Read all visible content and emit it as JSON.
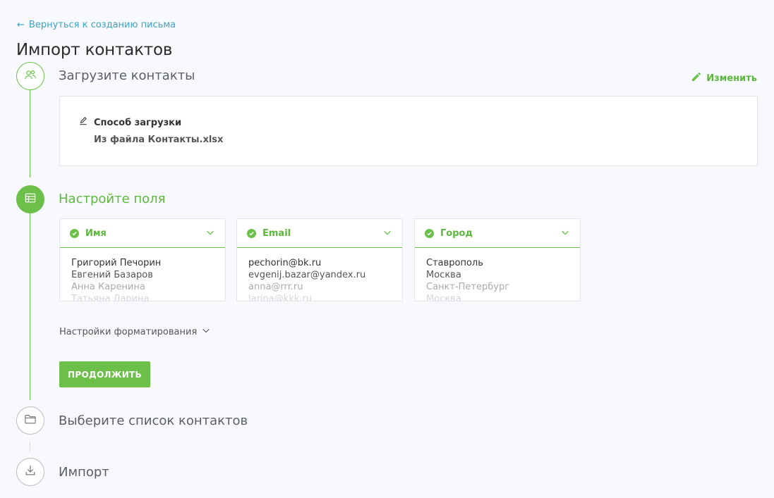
{
  "header": {
    "back_link": "Вернуться к созданию письма",
    "title": "Импорт контактов"
  },
  "steps": [
    {
      "title": "Загрузите контакты",
      "status": "done",
      "icon": "users-icon"
    },
    {
      "title": "Настройте поля",
      "status": "active",
      "icon": "table-icon"
    },
    {
      "title": "Выберите список контактов",
      "status": "todo",
      "icon": "folder-icon"
    },
    {
      "title": "Импорт",
      "status": "todo",
      "icon": "download-icon"
    }
  ],
  "upload": {
    "edit_label": "Изменить",
    "method_label": "Способ загрузки",
    "file_label": "Из файла Контакты.xlsx"
  },
  "fields": [
    {
      "name": "Имя",
      "values": [
        "Григорий Печорин",
        "Евгений Базаров",
        "Анна Каренина",
        "Татьяна Ларина"
      ]
    },
    {
      "name": "Email",
      "values": [
        "pechorin@bk.ru",
        "evgenij.bazar@yandex.ru",
        "anna@rrr.ru",
        "larina@kkk.ru"
      ]
    },
    {
      "name": "Город",
      "values": [
        "Ставрополь",
        "Москва",
        "Санкт-Петербург",
        "Москва"
      ]
    }
  ],
  "format_settings_label": "Настройки форматирования",
  "continue_label": "ПРОДОЛЖИТЬ",
  "colors": {
    "accent": "#6cc04a",
    "link": "#3aa3c8",
    "muted_border": "#b8bcc3"
  }
}
